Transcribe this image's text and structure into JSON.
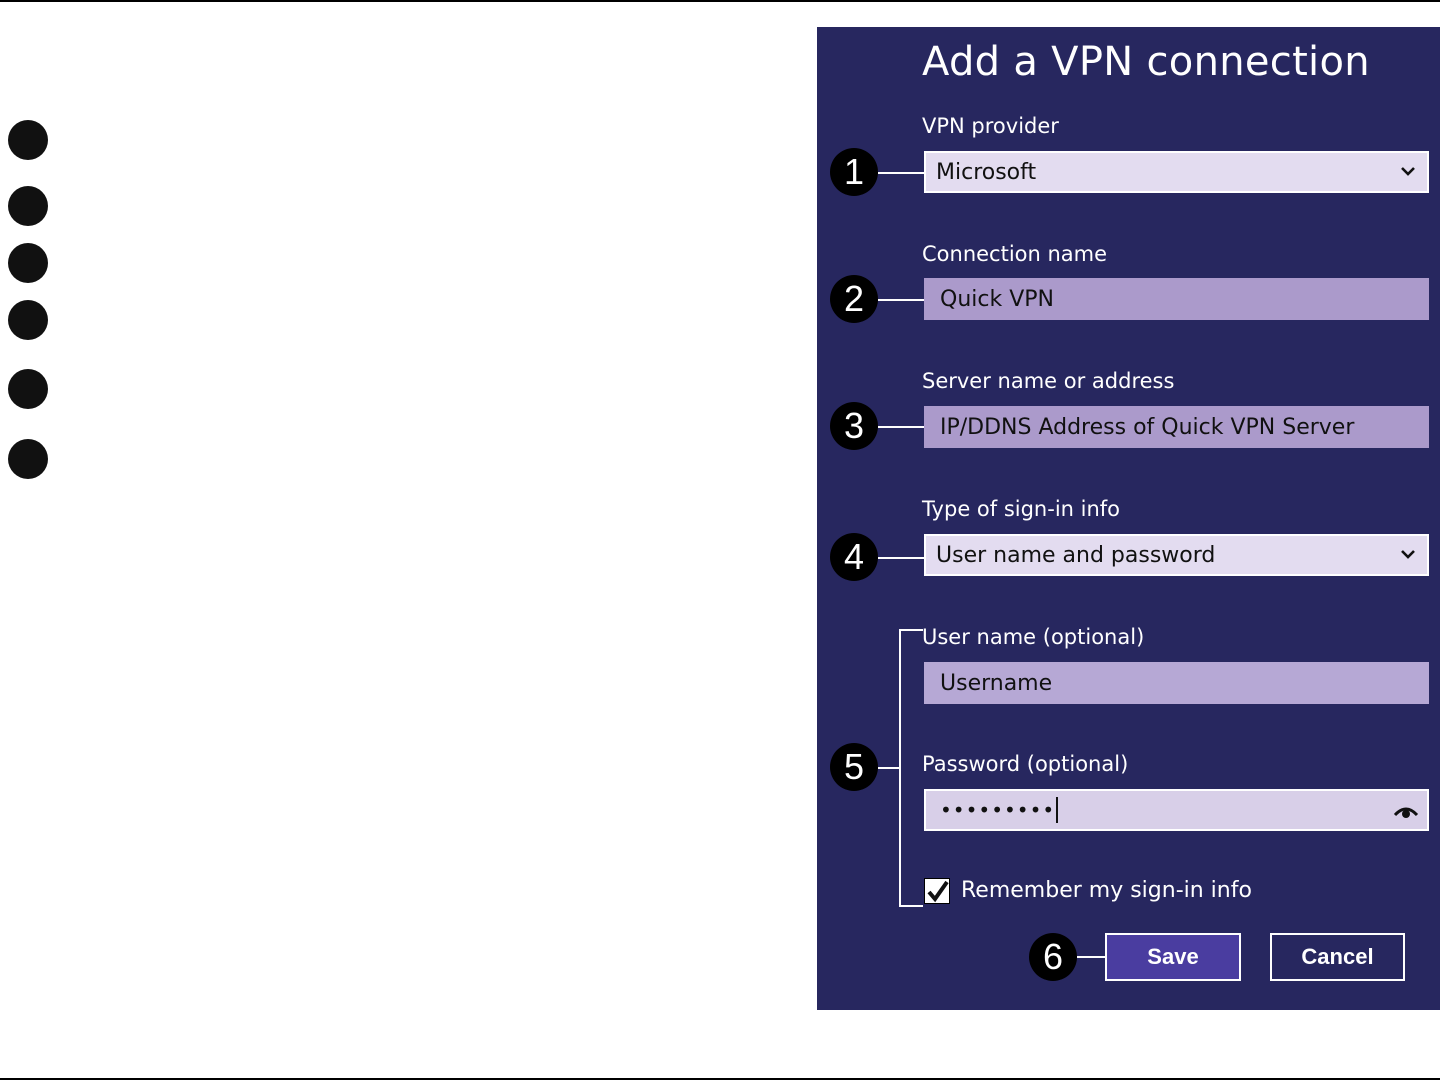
{
  "dialog": {
    "title": "Add a VPN connection",
    "vpn_provider": {
      "label": "VPN provider",
      "value": "Microsoft"
    },
    "connection_name": {
      "label": "Connection name",
      "value": "Quick VPN"
    },
    "server": {
      "label": "Server name or address",
      "value": "IP/DDNS Address of Quick VPN Server"
    },
    "sign_in_type": {
      "label": "Type of sign-in info",
      "value": "User name and password"
    },
    "username": {
      "label": "User name (optional)",
      "value": "Username"
    },
    "password": {
      "label": "Password (optional)",
      "value": "•••••••••"
    },
    "remember": {
      "label": "Remember my sign-in info",
      "checked": true
    },
    "save_label": "Save",
    "cancel_label": "Cancel"
  },
  "callouts": [
    "1",
    "2",
    "3",
    "4",
    "5",
    "6"
  ],
  "colors": {
    "panel_bg": "#27275f",
    "field_bg": "#ab9acb",
    "select_bg": "#e3dcf0",
    "save_bg": "#4a3da0"
  }
}
